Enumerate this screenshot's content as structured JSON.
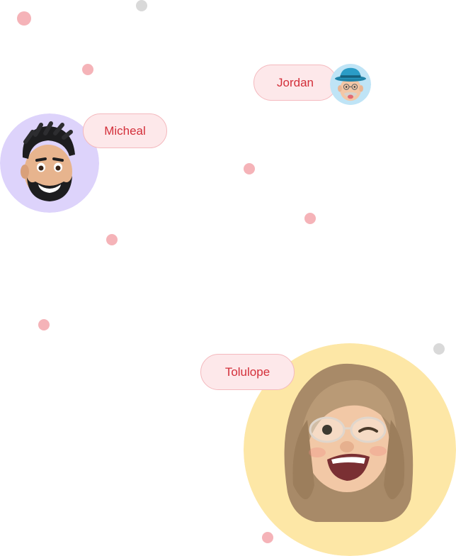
{
  "people": [
    {
      "name": "Jordan",
      "avatar_icon": "memoji-man-blue-hat-icon",
      "ring_color": "#bfe4f6"
    },
    {
      "name": "Micheal",
      "avatar_icon": "memoji-man-beard-icon",
      "ring_color": "#ddd3fb"
    },
    {
      "name": "Tolulope",
      "avatar_icon": "memoji-woman-winking-icon",
      "ring_color": "#fde7a6"
    }
  ],
  "colors": {
    "pill_background": "#fde8ea",
    "pill_border": "#f4b9be",
    "pill_text": "#d32f3a",
    "dot_pink": "#f5b3b8",
    "dot_gray": "#d9d9d9"
  }
}
